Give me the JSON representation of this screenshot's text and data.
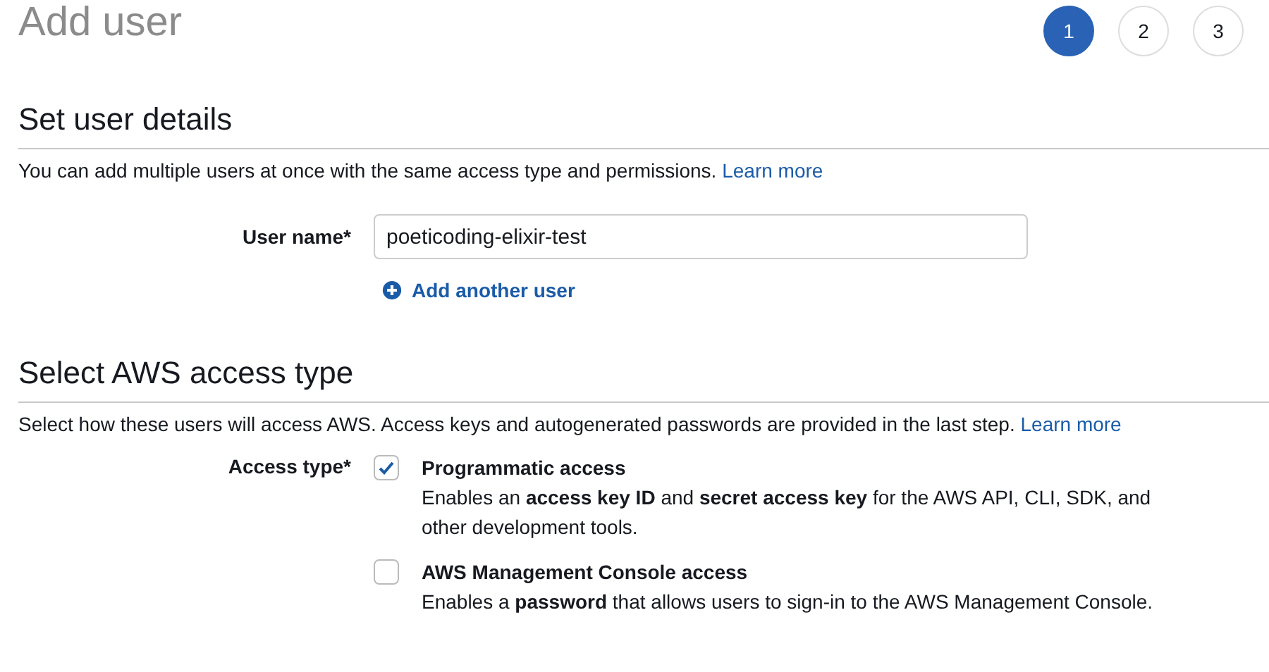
{
  "page_title": "Add user",
  "steps": [
    {
      "label": "1",
      "selected": true
    },
    {
      "label": "2",
      "selected": false
    },
    {
      "label": "3",
      "selected": false
    }
  ],
  "user_details": {
    "heading": "Set user details",
    "description": "You can add multiple users at once with the same access type and permissions.",
    "learn_more": "Learn more",
    "user_name_label": "User name*",
    "user_name_value": "poeticoding-elixir-test",
    "add_another": "Add another user"
  },
  "access": {
    "heading": "Select AWS access type",
    "description": "Select how these users will access AWS. Access keys and autogenerated passwords are provided in the last step.",
    "learn_more": "Learn more",
    "label": "Access type*",
    "options": [
      {
        "title": "Programmatic access",
        "description": "Enables an **access key ID** and **secret access key** for the AWS API, CLI, SDK, and other development tools.",
        "checked": true
      },
      {
        "title": "AWS Management Console access",
        "description": "Enables a **password** that allows users to sign-in to the AWS Management Console.",
        "checked": false
      }
    ]
  }
}
